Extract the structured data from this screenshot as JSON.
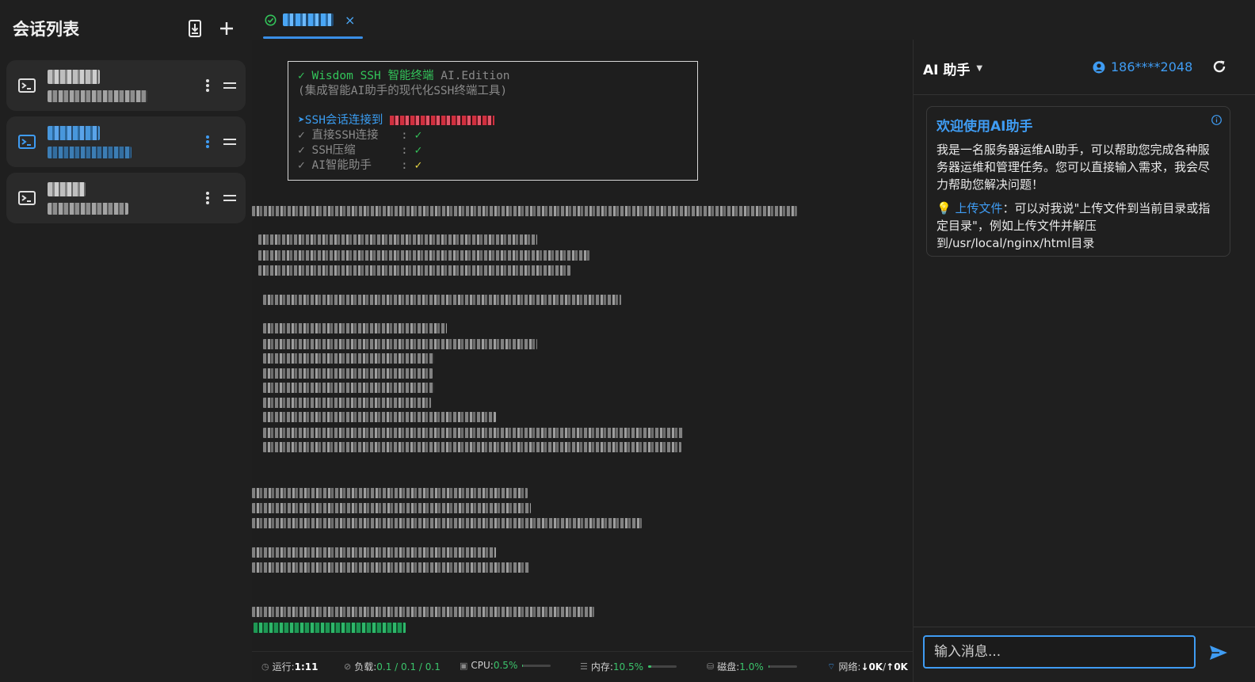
{
  "sidebar": {
    "title": "会话列表",
    "icons": {
      "import": "import-icon",
      "add": "plus-icon"
    },
    "sessions": [
      {
        "active": false
      },
      {
        "active": true
      },
      {
        "active": false
      }
    ]
  },
  "tabs": [
    {
      "close_label": "×",
      "status_icon": "check-circle-icon"
    }
  ],
  "terminal": {
    "banner": {
      "line1_check": "✓",
      "line1_name": "Wisdom SSH 智能终端",
      "line1_edition": "AI.Edition",
      "line2": "(集成智能AI助手的现代化SSH终端工具)",
      "connect_arrow": "➤",
      "connect_label": "SSH会话连接到",
      "features": [
        {
          "label": "✓ 直接SSH连接",
          "sep": ":",
          "mark": "✓",
          "color": "#33c45a"
        },
        {
          "label": "✓ SSH压缩",
          "sep": ":",
          "mark": "✓",
          "color": "#33c45a"
        },
        {
          "label": "✓ AI智能助手",
          "sep": ":",
          "mark": "✓",
          "color": "#e9d844"
        }
      ]
    }
  },
  "statusbar": {
    "uptime_label": "运行:",
    "uptime_value": "1:11",
    "load_label": "负载:",
    "load_value": "0.1 / 0.1 / 0.1",
    "cpu_label": "CPU:",
    "cpu_value": "0.5%",
    "cpu_fraction": 0.005,
    "mem_label": "内存:",
    "mem_value": "10.5%",
    "mem_fraction": 0.105,
    "disk_label": "磁盘:",
    "disk_value": "1.0%",
    "disk_fraction": 0.01,
    "net_label": "网络:",
    "net_down": "↓0K",
    "net_up": "↑0K"
  },
  "ai": {
    "title": "AI 助手",
    "user": "186****2048",
    "welcome_title": "欢迎使用AI助手",
    "welcome_text": "我是一名服务器运维AI助手，可以帮助您完成各种服务器运维和管理任务。您可以直接输入需求，我会尽力帮助您解决问题！",
    "tip_icon": "💡",
    "tip_link": "上传文件",
    "tip_text": "：可以对我说\"上传文件到当前目录或指定目录\"，例如上传文件并解压到/usr/local/nginx/html目录",
    "input_placeholder": "输入消息...",
    "accent": "#3f9cf3"
  }
}
